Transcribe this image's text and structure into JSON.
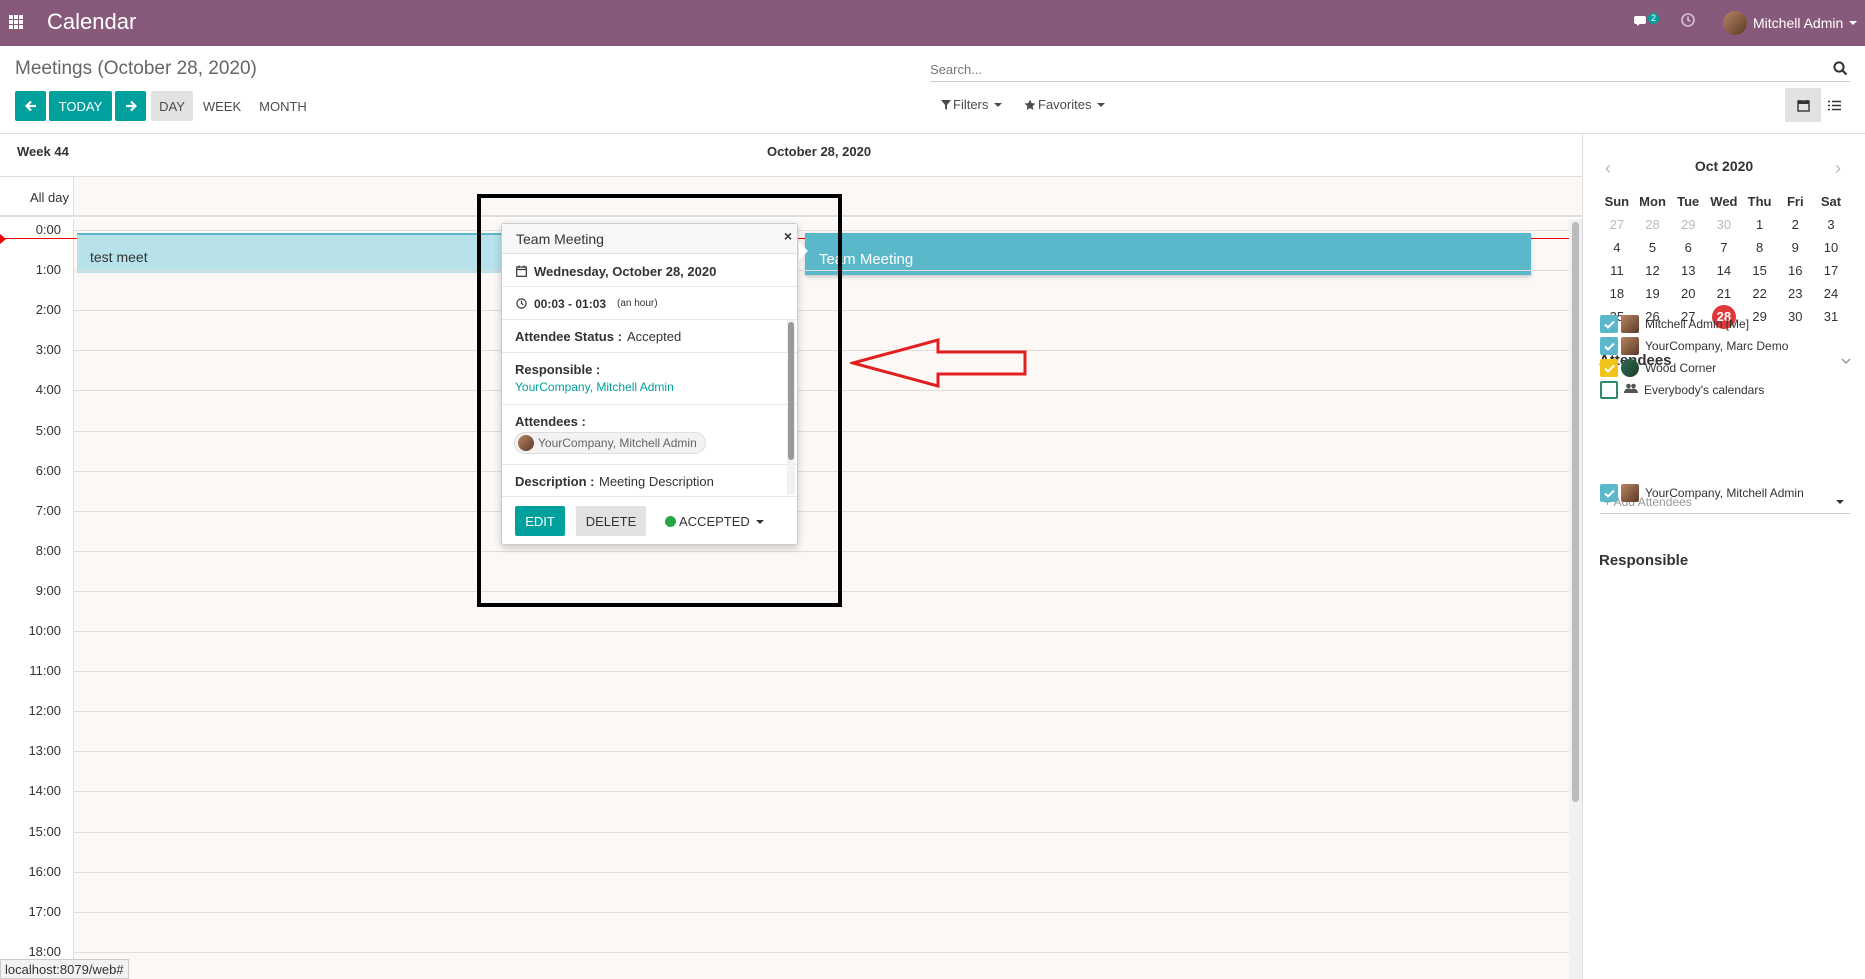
{
  "navbar": {
    "app_title": "Calendar",
    "chat_badge": "2",
    "user_name": "Mitchell Admin",
    "icons": [
      "apps-grid-icon",
      "chat-icon",
      "clock-icon",
      "avatar"
    ]
  },
  "control_panel": {
    "title": "Meetings (October 28, 2020)",
    "search_placeholder": "Search...",
    "today_label": "TODAY",
    "scales": [
      "DAY",
      "WEEK",
      "MONTH"
    ],
    "active_scale": "DAY",
    "filters_label": "Filters",
    "favorites_label": "Favorites"
  },
  "calendar": {
    "week_label": "Week 44",
    "date_label": "October 28, 2020",
    "allday_label": "All day",
    "hours": [
      "0:00",
      "1:00",
      "2:00",
      "3:00",
      "4:00",
      "5:00",
      "6:00",
      "7:00",
      "8:00",
      "9:00",
      "10:00",
      "11:00",
      "12:00",
      "13:00",
      "14:00",
      "15:00",
      "16:00",
      "17:00",
      "18:00"
    ],
    "events": [
      {
        "title": "test meet"
      },
      {
        "title": "Team Meeting"
      }
    ]
  },
  "popover": {
    "title": "Team Meeting",
    "close_label": "×",
    "date": "Wednesday, October 28, 2020",
    "time": "00:03 - 01:03",
    "duration": "(an hour)",
    "attendee_status_label": "Attendee Status :",
    "attendee_status_value": "Accepted",
    "responsible_label": "Responsible :",
    "responsible_value": "YourCompany, Mitchell Admin",
    "attendees_label": "Attendees :",
    "attendees_tag": "YourCompany, Mitchell Admin",
    "description_label": "Description :",
    "description_value": "Meeting Description",
    "edit_label": "EDIT",
    "delete_label": "DELETE",
    "accepted_label": "ACCEPTED"
  },
  "sidebar": {
    "mini_calendar": {
      "title": "Oct 2020",
      "weekdays": [
        "Sun",
        "Mon",
        "Tue",
        "Wed",
        "Thu",
        "Fri",
        "Sat"
      ],
      "weeks": [
        [
          "27",
          "28",
          "29",
          "30",
          "1",
          "2",
          "3"
        ],
        [
          "4",
          "5",
          "6",
          "7",
          "8",
          "9",
          "10"
        ],
        [
          "11",
          "12",
          "13",
          "14",
          "15",
          "16",
          "17"
        ],
        [
          "18",
          "19",
          "20",
          "21",
          "22",
          "23",
          "24"
        ],
        [
          "25",
          "26",
          "27",
          "28",
          "29",
          "30",
          "31"
        ]
      ],
      "today": "28"
    },
    "attendees_title": "Attendees",
    "attendees": [
      {
        "name": "Mitchell Admin [Me]",
        "state": "checked"
      },
      {
        "name": "YourCompany, Marc Demo",
        "state": "checked"
      },
      {
        "name": "Wood Corner",
        "state": "yellow"
      },
      {
        "name": "Everybody's calendars",
        "state": "empty"
      }
    ],
    "add_attendees_placeholder": "+ Add Attendees",
    "responsible_title": "Responsible",
    "responsible": [
      {
        "name": "YourCompany, Mitchell Admin",
        "state": "checked"
      }
    ]
  },
  "status_bar": {
    "url": "localhost:8079/web#"
  }
}
